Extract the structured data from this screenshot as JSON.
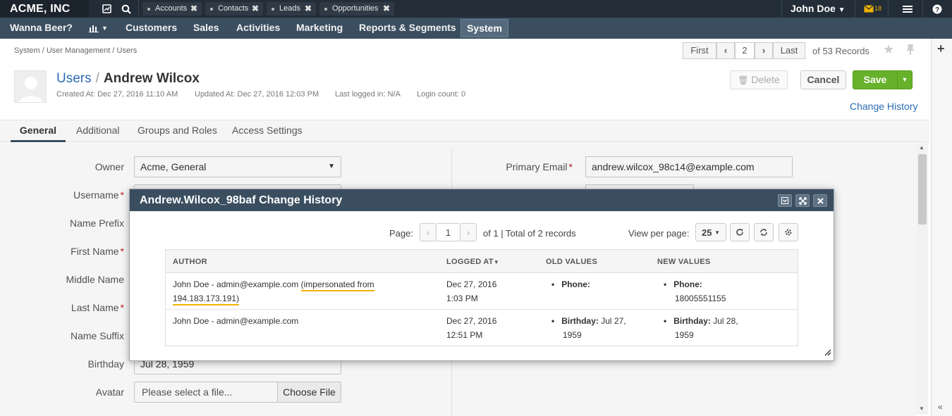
{
  "topbar": {
    "brand": "ACME, INC",
    "pinned_tabs": [
      {
        "label": "Accounts"
      },
      {
        "label": "Contacts"
      },
      {
        "label": "Leads"
      },
      {
        "label": "Opportunities"
      }
    ],
    "user_name": "John Doe",
    "mail_count": "18"
  },
  "nav": {
    "items": [
      "Wanna Beer?",
      "Customers",
      "Sales",
      "Activities",
      "Marketing",
      "Reports & Segments",
      "System"
    ]
  },
  "breadcrumb": "System / User Management / Users",
  "pagination": {
    "first": "First",
    "current": "2",
    "last": "Last",
    "records": "of 53 Records"
  },
  "header": {
    "parent_link": "Users",
    "separator": "/",
    "name": "Andrew Wilcox",
    "created": "Created At: Dec 27, 2016 11:10 AM",
    "updated": "Updated At: Dec 27, 2016 12:03 PM",
    "last_logged": "Last logged in: N/A",
    "login_count": "Login count: 0",
    "delete_label": "Delete",
    "cancel_label": "Cancel",
    "save_label": "Save",
    "change_history": "Change History"
  },
  "tabs": [
    "General",
    "Additional",
    "Groups and Roles",
    "Access Settings"
  ],
  "form": {
    "owner_label": "Owner",
    "owner_value": "Acme, General",
    "username_label": "Username",
    "prefix_label": "Name Prefix",
    "first_label": "First Name",
    "middle_label": "Middle Name",
    "last_label": "Last Name",
    "suffix_label": "Name Suffix",
    "birthday_label": "Birthday",
    "birthday_value": "Jul 28, 1959",
    "avatar_label": "Avatar",
    "avatar_placeholder": "Please select a file...",
    "choose_file": "Choose File",
    "email_label": "Primary Email",
    "email_value": "andrew.wilcox_98c14@example.com",
    "required_mark": "*"
  },
  "dialog": {
    "title": "Andrew.Wilcox_98baf Change History",
    "page_label": "Page:",
    "page_value": "1",
    "page_info": "of 1 | Total of 2 records",
    "view_per_page_label": "View per page:",
    "view_per_page_value": "25",
    "columns": [
      "AUTHOR",
      "LOGGED AT",
      "OLD VALUES",
      "NEW VALUES"
    ],
    "rows": [
      {
        "author": "John Doe - admin@example.com",
        "author_note": "(impersonated from 194.183.173.191)",
        "date": "Dec 27, 2016",
        "time": "1:03 PM",
        "old_field": "Phone:",
        "old_value": "",
        "new_field": "Phone:",
        "new_value": "18005551155"
      },
      {
        "author": "John Doe - admin@example.com",
        "author_note": "",
        "date": "Dec 27, 2016",
        "time": "12:51 PM",
        "old_field": "Birthday:",
        "old_value": "Jul 27,",
        "old_value2": "1959",
        "new_field": "Birthday:",
        "new_value": "Jul 28,",
        "new_value2": "1959"
      }
    ]
  },
  "colors": {
    "topbar": "#232d38",
    "navbar": "#3a4e60",
    "accent": "#2b6cb4",
    "save": "#67b22b",
    "highlight": "#f1b300"
  }
}
